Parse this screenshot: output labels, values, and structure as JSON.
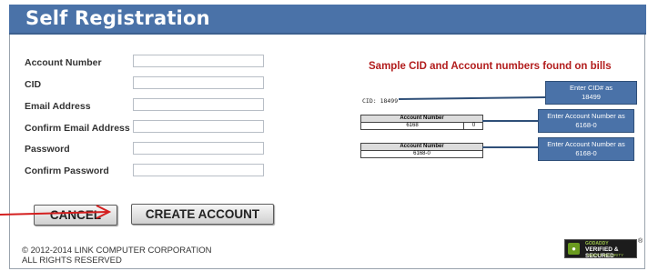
{
  "header": {
    "title": "Self Registration"
  },
  "form": {
    "fields": [
      {
        "label": "Account Number",
        "value": ""
      },
      {
        "label": "CID",
        "value": ""
      },
      {
        "label": "Email Address",
        "value": ""
      },
      {
        "label": "Confirm Email Address",
        "value": ""
      },
      {
        "label": "Password",
        "value": ""
      },
      {
        "label": "Confirm Password",
        "value": ""
      }
    ],
    "cancel_label": "CANCEL",
    "create_label": "CREATE ACCOUNT"
  },
  "sample": {
    "title": "Sample CID and Account numbers found on bills",
    "cid_text": "CID: 18499",
    "cid_callout": {
      "line1": "Enter CID# as",
      "line2": "18499"
    },
    "acct1": {
      "header": "Account Number",
      "number": "6168",
      "suffix": "0"
    },
    "acct1_callout": {
      "line1": "Enter Account Number as",
      "line2": "6168-0"
    },
    "acct2": {
      "header": "Account Number",
      "number": "6168-0"
    },
    "acct2_callout": {
      "line1": "Enter Account Number as",
      "line2": "6168-0"
    }
  },
  "footer": {
    "copyright": "© 2012-2014 LINK COMPUTER CORPORATION",
    "rights": "ALL RIGHTS RESERVED",
    "badge": {
      "brand": "GODADDY",
      "main": "VERIFIED & SECURED",
      "sub": "VERIFY SECURITY",
      "reg": "®"
    }
  },
  "colors": {
    "header_bg": "#4a72a8",
    "sample_title": "#b21d1d",
    "arrow": "#d41f1f",
    "callout_bg": "#4a72a8"
  },
  "icons": {
    "badge_icon": "lock-icon",
    "annotation": "red-arrow-icon"
  }
}
